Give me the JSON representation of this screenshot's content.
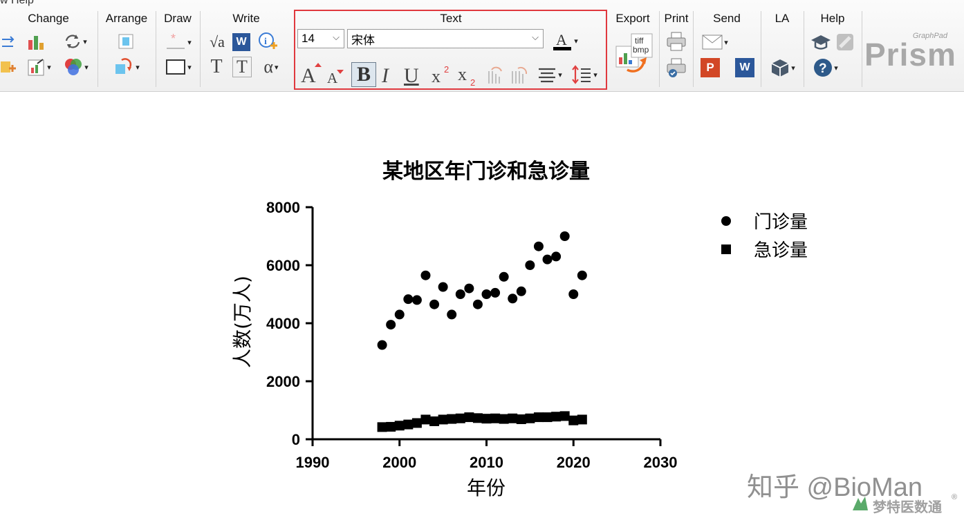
{
  "menu_hint": "w  Help",
  "ribbon": {
    "groups": {
      "change": "Change",
      "arrange": "Arrange",
      "draw": "Draw",
      "write": "Write",
      "text": "Text",
      "export": "Export",
      "print": "Print",
      "send": "Send",
      "la": "LA",
      "help": "Help"
    },
    "text": {
      "font_size": "14",
      "font_name": "宋体",
      "bold": "B",
      "italic": "I",
      "underline": "U"
    },
    "write": {
      "sqrt": "√a",
      "word": "W",
      "t_plain": "T",
      "t_box": "T",
      "alpha": "α"
    },
    "export": {
      "tiff": "tiff",
      "bmp": "bmp"
    },
    "send": {
      "ppt": "P",
      "word": "W"
    },
    "logo": {
      "small": "GraphPad",
      "big": "Prism"
    }
  },
  "chart_data": {
    "type": "scatter",
    "title": "某地区年门诊和急诊量",
    "xlabel": "年份",
    "ylabel": "人数(万人)",
    "xlim": [
      1990,
      2030
    ],
    "ylim": [
      0,
      8000
    ],
    "xticks": [
      "1990",
      "2000",
      "2010",
      "2020",
      "2030"
    ],
    "yticks": [
      "0",
      "2000",
      "4000",
      "6000",
      "8000"
    ],
    "legend_position": "top-right",
    "series": [
      {
        "name": "门诊量",
        "marker": "circle",
        "x": [
          1998,
          1999,
          2000,
          2001,
          2002,
          2003,
          2004,
          2005,
          2006,
          2007,
          2008,
          2009,
          2010,
          2011,
          2012,
          2013,
          2014,
          2015,
          2016,
          2017,
          2018,
          2019,
          2020,
          2021
        ],
        "y": [
          3250,
          3950,
          4300,
          4830,
          4800,
          5650,
          4650,
          5250,
          4300,
          5000,
          5200,
          4650,
          5000,
          5050,
          5600,
          4850,
          5100,
          6000,
          6650,
          6200,
          6300,
          7000,
          5000,
          5650
        ]
      },
      {
        "name": "急诊量",
        "marker": "square",
        "x": [
          1998,
          1999,
          2000,
          2001,
          2002,
          2003,
          2004,
          2005,
          2006,
          2007,
          2008,
          2009,
          2010,
          2011,
          2012,
          2013,
          2014,
          2015,
          2016,
          2017,
          2018,
          2019,
          2020,
          2021
        ],
        "y": [
          420,
          430,
          470,
          510,
          560,
          680,
          620,
          680,
          700,
          720,
          760,
          730,
          710,
          720,
          700,
          720,
          690,
          720,
          760,
          760,
          780,
          800,
          650,
          680
        ]
      }
    ]
  },
  "watermark": {
    "zhihu": "知乎 @BioMan",
    "brand": "梦特医数通",
    "registered": "®"
  },
  "colors": {
    "highlight": "#e0383e",
    "marker": "#000000"
  }
}
